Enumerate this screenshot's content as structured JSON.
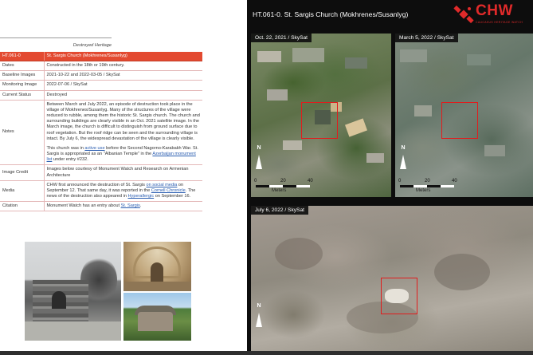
{
  "document": {
    "header": "Destroyed Heritage",
    "table": {
      "head": {
        "key": "HT.061-0",
        "value": "St. Sargis Church (Mokhrenes/Susanlyg)"
      },
      "dates": {
        "key": "Dates",
        "value": "Constructed in the 18th or 19th century."
      },
      "baseline": {
        "key": "Baseline Images",
        "value": "2021-10-22 and 2022-03-05 / SkySat"
      },
      "monitoring": {
        "key": "Monitoring Image",
        "value": "2022-07-06 / SkySat"
      },
      "status": {
        "key": "Current Status",
        "value": "Destroyed"
      },
      "notes": {
        "key": "Notes",
        "p1": "Between March and July 2022, an episode of destruction took place in the village of Mokhrenes/Susanlyg. Many of the structures of the village were reduced to rubble, among them the historic St. Sargis church. The church and surrounding buildings are clearly visible in an Oct. 2021 satellite image. In the March image, the church is difficult to distinguish from ground surface due to roof vegetation. But the roof ridge can be seen and the surrounding village is intact. By July 6, the widespread devastation of the village is clearly visible.",
        "p2_a": "This church was in ",
        "p2_link1": "active use",
        "p2_b": " before the Second Nagorno-Karabakh War. St. Sargis is appropriated as an \"Albanian Temple\" in the ",
        "p2_link2": "Azerbaijan monument list",
        "p2_c": " under entry #232."
      },
      "credit": {
        "key": "Image Credit",
        "value": "Images below courtesy of Monument Watch and Research on Armenian Architecture"
      },
      "media": {
        "key": "Media",
        "a": "CHW first announced the destruction of St. Sargis ",
        "link1": "on social media",
        "b": " on September 12. That same day, it was reported in the ",
        "link2": "Cornell Chronicle",
        "c": ". The news of the destruction also appeared in ",
        "link3": "Hyperallergic",
        "d": " on September 16."
      },
      "citation": {
        "key": "Citation",
        "a": "Monument Watch has an entry about ",
        "link": "St. Sargis",
        "b": "."
      }
    },
    "photos": [
      "church ruins photo",
      "church interior photo",
      "church exterior photo"
    ]
  },
  "satellite": {
    "title": "HT.061-0. St. Sargis Church (Mokhrenes/Susanlyg)",
    "logo": {
      "text": "CHW",
      "subtitle": "CAUCASUS HERITAGE WATCH"
    },
    "panels": [
      {
        "label": "Oct. 22, 2021 / SkySat"
      },
      {
        "label": "March 5, 2022 / SkySat"
      },
      {
        "label": "July 6, 2022 / SkySat"
      }
    ],
    "north": "N",
    "scale": {
      "ticks": [
        "0",
        "20",
        "40"
      ],
      "unit": "Meters"
    }
  },
  "colors": {
    "accent": "#e34a31",
    "logo_red": "#e02a2a",
    "target_box": "#e01d1d",
    "link": "#2a5db0"
  }
}
